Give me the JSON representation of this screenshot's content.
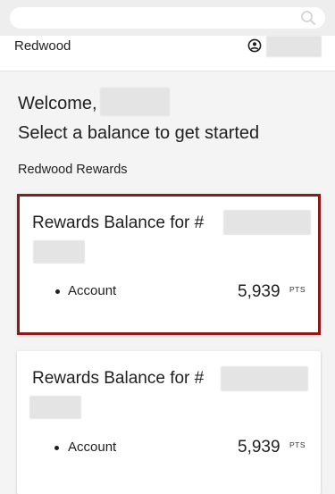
{
  "search": {
    "placeholder": "",
    "icon": "search-icon"
  },
  "header": {
    "brand": "Redwood",
    "user_icon": "user-circle-icon"
  },
  "main": {
    "welcome": "Welcome,",
    "subtitle": "Select a balance to get started",
    "section_label": "Redwood Rewards",
    "selected_border_color": "#8b1a1a"
  },
  "cards": [
    {
      "title": "Rewards Balance for #",
      "account_label": "Account",
      "points": "5,939",
      "unit": "PTS",
      "selected": true
    },
    {
      "title": "Rewards Balance for #",
      "account_label": "Account",
      "points": "5,939",
      "unit": "PTS",
      "selected": false
    }
  ]
}
